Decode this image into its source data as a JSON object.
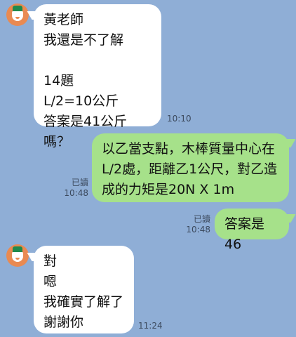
{
  "messages": [
    {
      "side": "in",
      "text": "黃老師\n我還是不了解\n\n14題\nL/2=10公斤\n答案是41公斤嗎？",
      "time": "10:10"
    },
    {
      "side": "out",
      "text": "以乙當支點，木棒質量中心在\nL/2處，距離乙1公尺，對乙造\n成的力矩是20N X 1m",
      "read": "已讀",
      "time": "10:48"
    },
    {
      "side": "out",
      "text": "答案是46",
      "read": "已讀",
      "time": "10:48"
    },
    {
      "side": "in",
      "text": "對\n嗯\n我確實了解了\n謝謝你",
      "time": "11:24"
    }
  ],
  "colors": {
    "background": "#8faed6",
    "incoming": "#ffffff",
    "outgoing": "#a6e18a",
    "avatar": "#e98a52"
  },
  "icons": {
    "avatar": "teacher-avatar-icon"
  }
}
